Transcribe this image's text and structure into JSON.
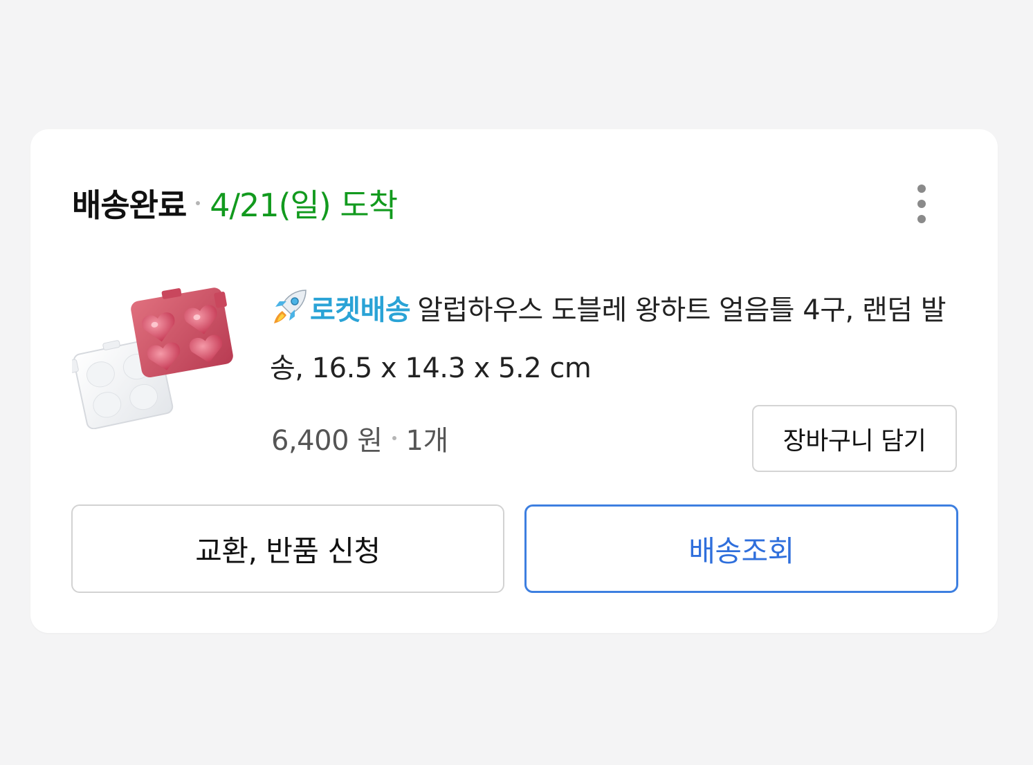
{
  "order": {
    "status": "배송완료",
    "arrival": "4/21(일) 도착",
    "more_icon": "more-vertical-icon"
  },
  "product": {
    "badge_icon": "rocket-icon",
    "badge_label": "로켓배송",
    "title": "알럽하우스 도블레 왕하트 얼음틀 4구, 랜덤 발송, 16.5 x 14.3 x 5.2 cm",
    "price": "6,400 원",
    "quantity": "1개",
    "cart_button": "장바구니 담기"
  },
  "actions": {
    "return_button": "교환, 반품 신청",
    "track_button": "배송조회"
  },
  "colors": {
    "arrival_green": "#129a1e",
    "rocket_blue": "#2aa3d6",
    "track_blue": "#3d7fe0"
  }
}
